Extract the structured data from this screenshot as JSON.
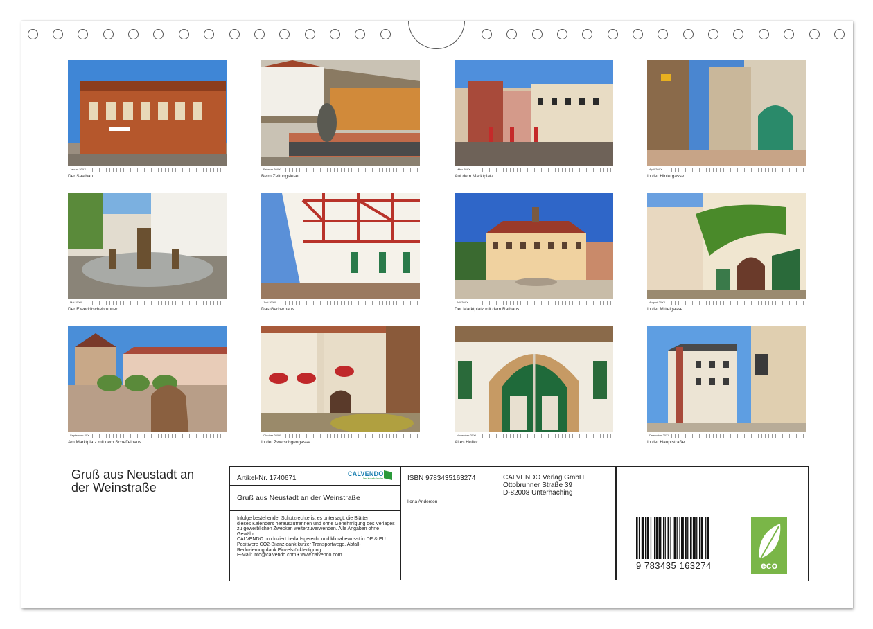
{
  "calendar": {
    "photos": [
      {
        "month": "Januar 20XX",
        "caption": "Der Saalbau"
      },
      {
        "month": "Februar 20XX",
        "caption": "Beim Zeitungsleser"
      },
      {
        "month": "März 20XX",
        "caption": "Auf dem Marktplatz"
      },
      {
        "month": "April 20XX",
        "caption": "In der Hintergasse"
      },
      {
        "month": "Mai 20XX",
        "caption": "Der Elwedritschebrunnen"
      },
      {
        "month": "Juni 20XX",
        "caption": "Das Gerberhaus"
      },
      {
        "month": "Juli 20XX",
        "caption": "Der Marktplatz mit dem Rathaus"
      },
      {
        "month": "August 20XX",
        "caption": "In der Mittelgasse"
      },
      {
        "month": "September 20XX",
        "caption": "Am Marktplatz mit dem Scheffelhaus"
      },
      {
        "month": "Oktober 20XX",
        "caption": "In der Zwetschgengasse"
      },
      {
        "month": "November 20XX",
        "caption": "Altes Hoftor"
      },
      {
        "month": "Dezember 20XX",
        "caption": "In der Hauptstraße"
      }
    ],
    "title_line1": "Gruß aus Neustadt an",
    "title_line2": "der Weinstraße"
  },
  "info": {
    "article": "Artikel-Nr. 1740671",
    "logo": "CALVENDO",
    "logo_sub": "Der Kunstkalender",
    "product_title": "Gruß aus Neustadt an der Weinstraße",
    "legal": "Infolge bestehender Schutzrechte ist es untersagt, die Blätter\ndieses Kalenders herauszutrennen und ohne Genehmigung des Verlages\nzu gewerblichen Zwecken weiterzuverwenden. Alle Angaben ohne\nGewähr.\nCALVENDO produziert bedarfsgerecht und klimabewusst in DE & EU.\nPositivere CO2-Bilanz dank kurzer Transportwege. Abfall-\nReduzierung dank Einzelstückfertigung.\nE-Mail: info@calvendo.com • www.calvendo.com",
    "isbn": "ISBN 9783435163274",
    "author": "Ilona Andersen",
    "publisher_line1": "CALVENDO Verlag GmbH",
    "publisher_line2": "Ottobrunner Straße 39",
    "publisher_line3": "D-82008 Unterhaching",
    "barcode_digits": "9  783435  163274",
    "eco_label": "eco"
  },
  "colors": {
    "sky": "#3a7fd0",
    "eco_green": "#7ab648",
    "brand_blue": "#1a7fb0"
  }
}
